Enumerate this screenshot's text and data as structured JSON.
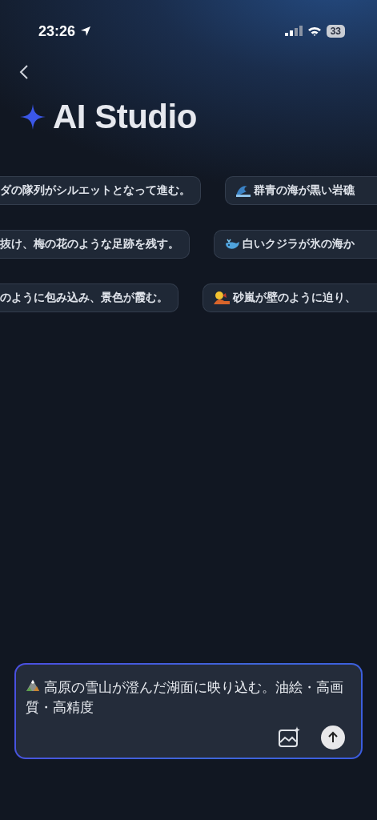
{
  "status_bar": {
    "time": "23:26",
    "battery": "33"
  },
  "title": "AI Studio",
  "suggestion_rows": [
    {
      "left": {
        "text": "ダの隊列がシルエットとなって進む。"
      },
      "right": {
        "kind": "wave",
        "text": "群青の海が黒い岩礁"
      }
    },
    {
      "left": {
        "text": "抜け、梅の花のような足跡を残す。"
      },
      "right": {
        "kind": "whale",
        "text": "白いクジラが氷の海か"
      }
    },
    {
      "left": {
        "text": "のように包み込み、景色が霞む。"
      },
      "right": {
        "kind": "sandstorm",
        "text": "砂嵐が壁のように迫り、"
      }
    }
  ],
  "prompt": {
    "kind": "mountain",
    "value": "高原の雪山が澄んだ湖面に映り込む。油絵・高画質・高精度"
  }
}
